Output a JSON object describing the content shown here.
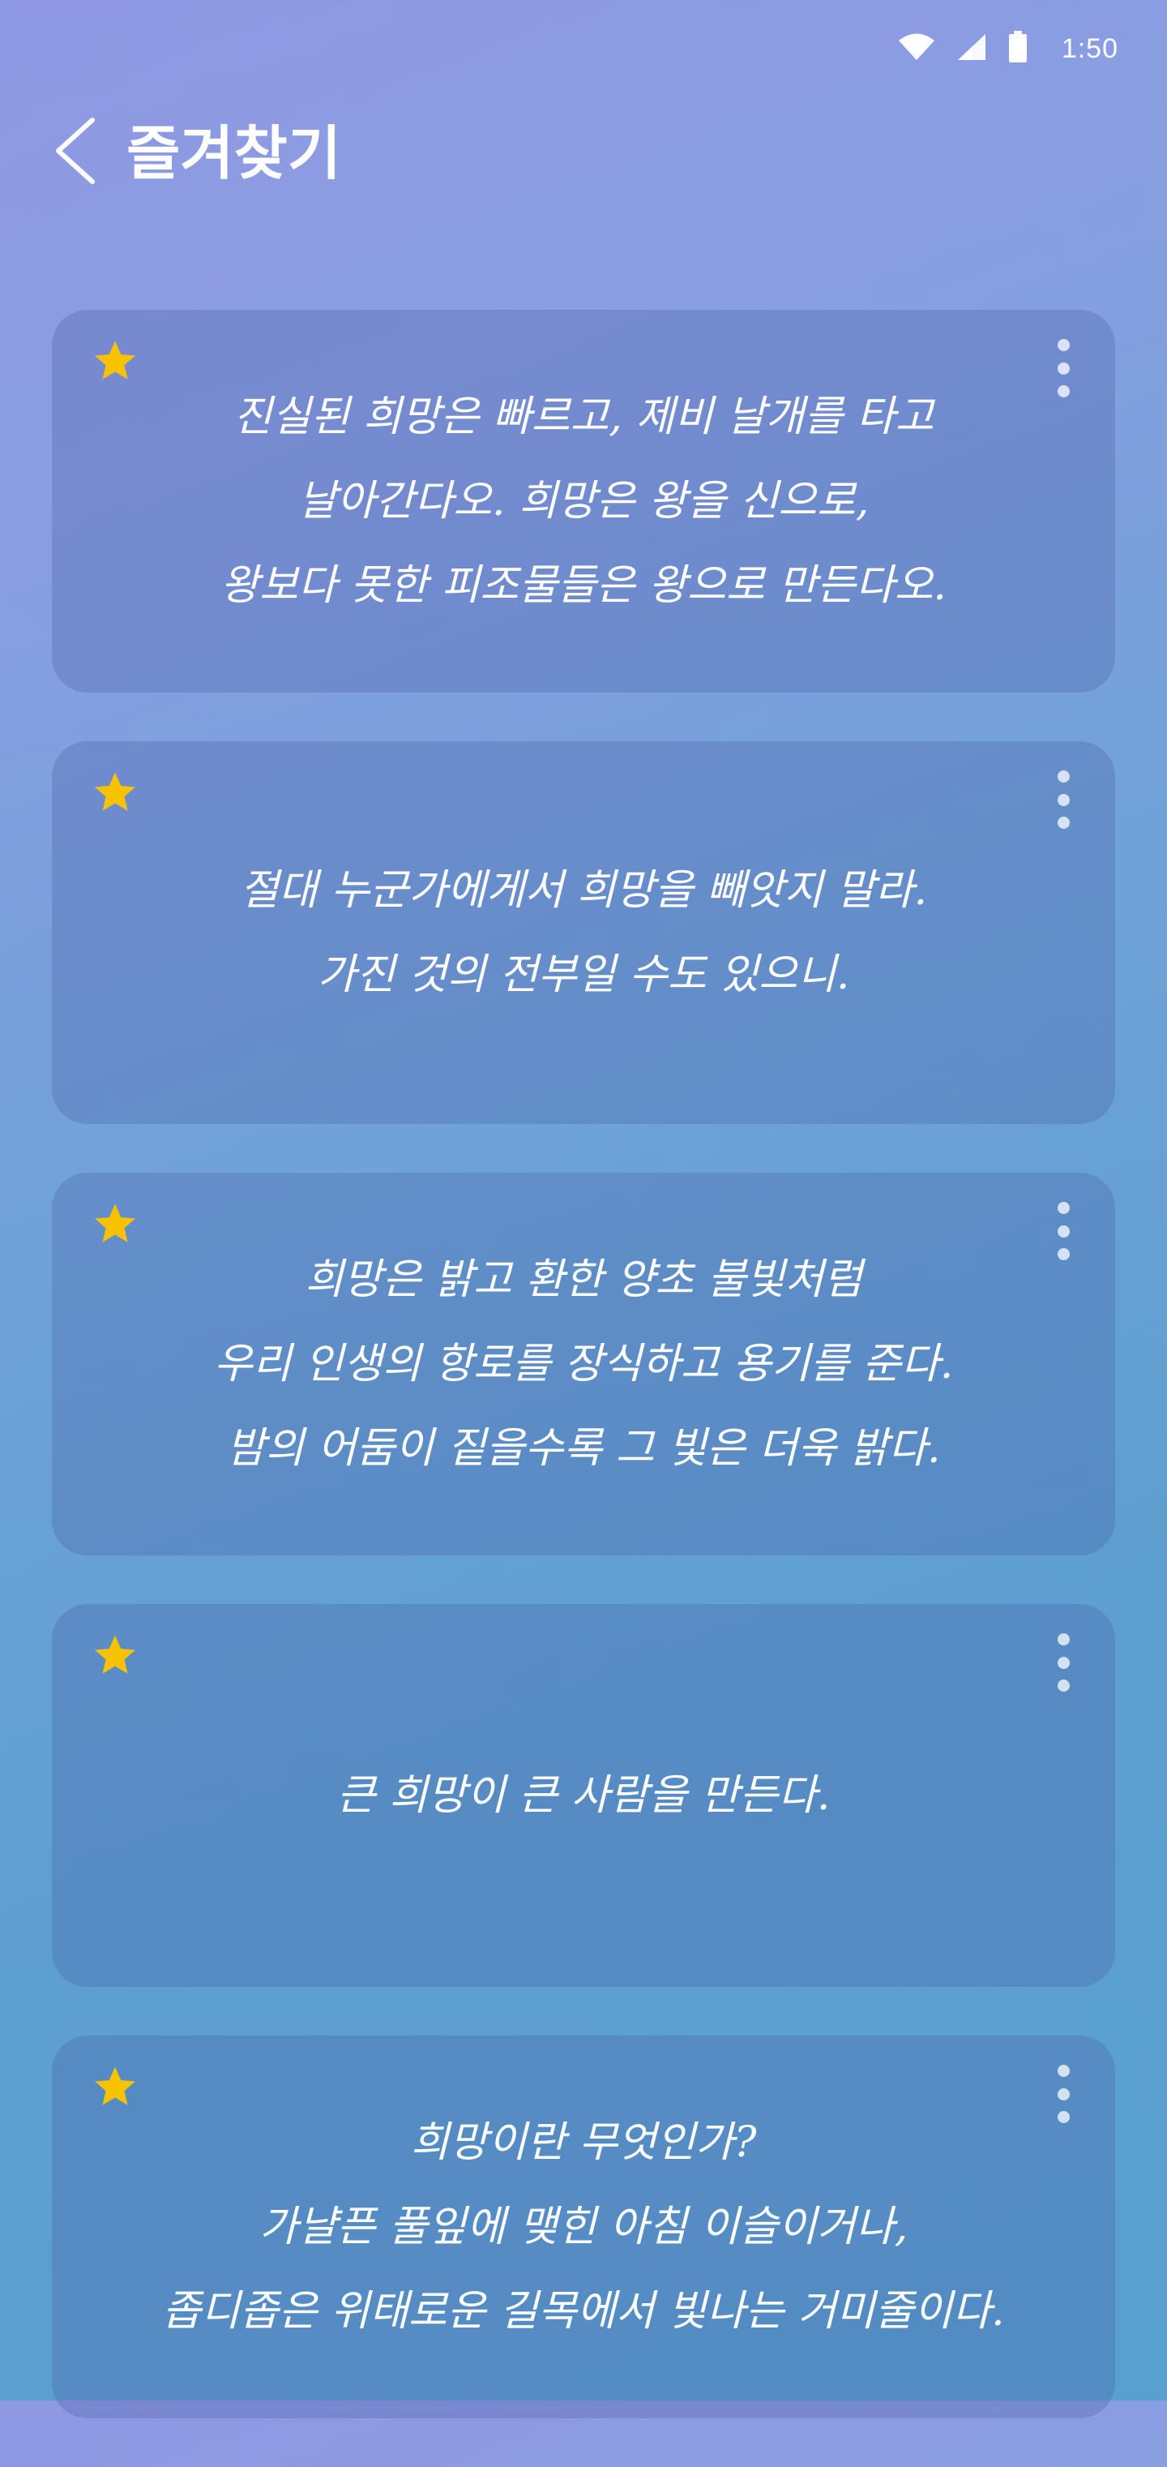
{
  "status_bar": {
    "time": "1:50",
    "icons": [
      "wifi-icon",
      "signal-icon",
      "battery-icon"
    ]
  },
  "header": {
    "title": "즐겨찾기",
    "back_icon": "chevron-left-icon"
  },
  "colors": {
    "star": "#F7C200",
    "text": "#FFFFFF"
  },
  "favorites": [
    {
      "starred": true,
      "lines": [
        "진실된 희망은 빠르고, 제비 날개를 타고",
        "날아간다오. 희망은 왕을 신으로,",
        "왕보다 못한 피조물들은 왕으로 만든다오."
      ]
    },
    {
      "starred": true,
      "lines": [
        "절대 누군가에게서 희망을 빼앗지 말라.",
        "가진 것의 전부일 수도 있으니."
      ]
    },
    {
      "starred": true,
      "lines": [
        "희망은 밝고 환한 양초 불빛처럼",
        "우리 인생의 항로를 장식하고 용기를 준다.",
        "밤의 어둠이 짙을수록 그 빛은 더욱 밝다."
      ]
    },
    {
      "starred": true,
      "lines": [
        "큰 희망이 큰 사람을 만든다."
      ]
    },
    {
      "starred": true,
      "lines": [
        "희망이란 무엇인가?",
        "가냘픈 풀잎에 맺힌 아침 이슬이거나,",
        "좁디좁은 위태로운 길목에서 빛나는 거미줄이다."
      ]
    }
  ]
}
